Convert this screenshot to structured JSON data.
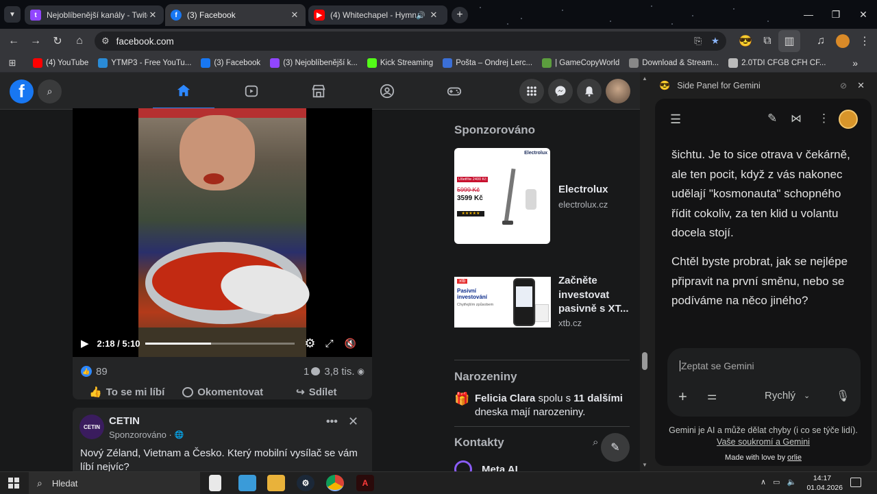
{
  "browser": {
    "tabs": [
      {
        "title": "Nejoblíbenější kanály - Twitch",
        "favicon_color": "#9146ff",
        "active": false
      },
      {
        "title": "(3) Facebook",
        "favicon_color": "#1877f2",
        "active": true
      },
      {
        "title": "(4) Whitechapel - Hymns in",
        "favicon_color": "#ff0000",
        "active": false
      }
    ],
    "url": "facebook.com",
    "bookmarks": [
      {
        "label": "(4) YouTube",
        "color": "#ff0000"
      },
      {
        "label": "YTMP3 - Free YouTu...",
        "color": "#2a8bd6"
      },
      {
        "label": "(3) Facebook",
        "color": "#1877f2"
      },
      {
        "label": "(3) Nejoblíbenější k...",
        "color": "#9146ff"
      },
      {
        "label": "Kick Streaming",
        "color": "#53fc18"
      },
      {
        "label": "Pošta – Ondrej Lerc...",
        "color": "#3b6fd6"
      },
      {
        "label": "| GameCopyWorld",
        "color": "#5c9d3e"
      },
      {
        "label": "Download & Stream...",
        "color": "#888888"
      },
      {
        "label": "2.0TDI CFGB CFH CF...",
        "color": "#bbbbbb"
      }
    ]
  },
  "facebook": {
    "video": {
      "time": "2:18 / 5:10",
      "progress": 0.44
    },
    "post_stats": {
      "likes": "89",
      "comments": "1",
      "views": "3,8 tis."
    },
    "actions": {
      "like": "To se mi líbí",
      "comment": "Okomentovat",
      "share": "Sdílet"
    },
    "ad_post": {
      "page_name": "CETIN",
      "sponsored": "Sponzorováno ·",
      "text": "Nový Zéland, Vietnam a Česko. Který mobilní vysílač se vám líbí nejvíc?",
      "logo_text": "CETIN"
    },
    "sidebar": {
      "sponsored_title": "Sponzorováno",
      "ads": [
        {
          "name": "Electrolux",
          "domain": "electrolux.cz",
          "img_brand": "Electrolux",
          "old_price": "5999 Kč",
          "new_price": "3599 Kč",
          "price_tag": "Ušetříte 2400 Kč"
        },
        {
          "name": "Začněte investovat pasivně s XT...",
          "domain": "xtb.cz",
          "img_brand": "xtb",
          "img_headline": "Pasivní investování",
          "img_sub": "Chytřejším způsobem"
        }
      ],
      "birthdays_title": "Narozeniny",
      "birthday_name": "Felicia Clara",
      "birthday_mid": " spolu s ",
      "birthday_others": "11 dalšími",
      "birthday_tail": "dneska mají narozeniny.",
      "contacts_title": "Kontakty",
      "meta_ai": "Meta AI"
    }
  },
  "gemini": {
    "panel_title": "Side Panel for Gemini",
    "messages": [
      "šichtu. Je to sice otrava v čekárně, ale ten pocit, když z vás nakonec udělají \"kosmonauta\" schopného řídit cokoliv, za ten klid u volantu docela stojí.",
      "Chtěl byste probrat, jak se nejlépe připravit na první směnu, nebo se podíváme na něco jiného?"
    ],
    "input_placeholder": "Zeptat se Gemini",
    "mode": "Rychlý",
    "disclaimer": "Gemini je AI a může dělat chyby (i co se týče lidí).",
    "privacy_link": "Vaše soukromí a Gemini",
    "made_with": "Made with love by",
    "author": "orlie"
  },
  "taskbar": {
    "search_label": "Hledat",
    "time": "14:17",
    "date": "01.04.2026"
  }
}
